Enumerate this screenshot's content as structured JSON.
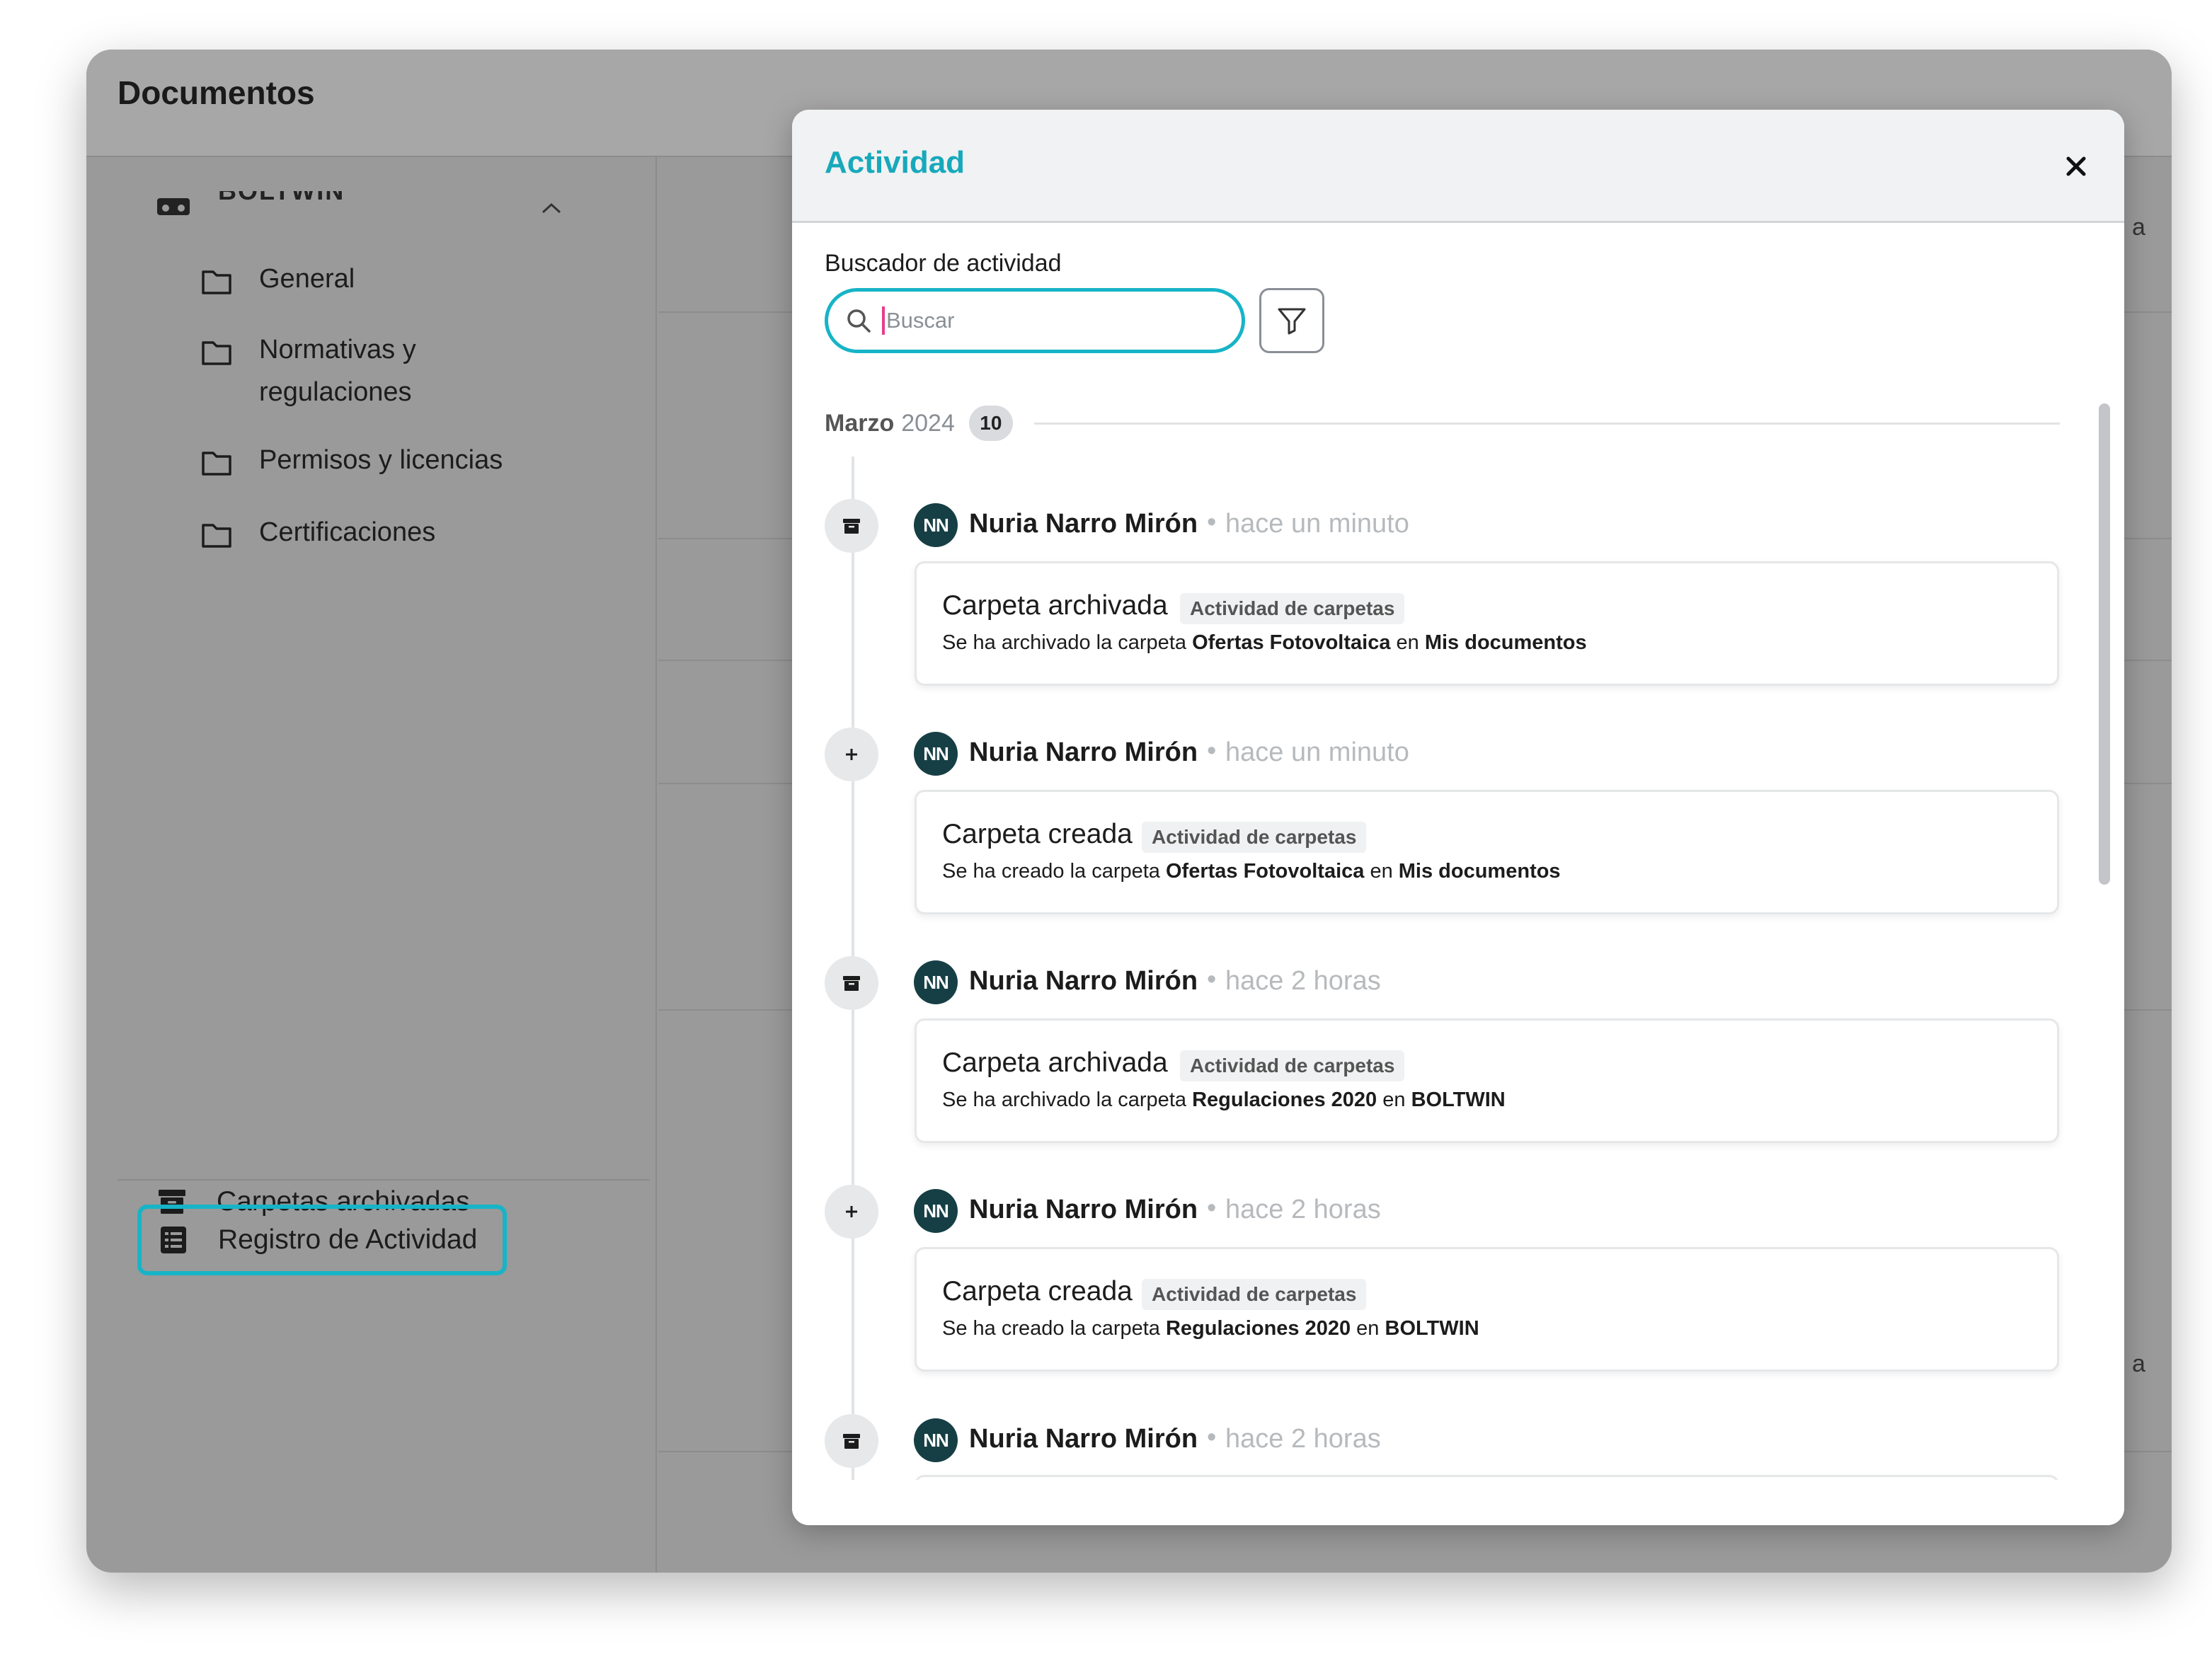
{
  "app": {
    "title": "Documentos"
  },
  "sidebar": {
    "workspace": "BOLTWIN",
    "folders": [
      {
        "label": "General"
      },
      {
        "label": "Normativas y"
      },
      {
        "label": "regulaciones"
      },
      {
        "label": "Permisos y licencias"
      },
      {
        "label": "Certificaciones"
      }
    ],
    "archived_label": "Carpetas archivadas",
    "activity_log_label": "Registro de Actividad"
  },
  "background": {
    "edge_text": "a"
  },
  "modal": {
    "title": "Actividad",
    "search_label": "Buscador de actividad",
    "search_placeholder": "Buscar",
    "month": "Marzo",
    "year": "2024",
    "count": "10",
    "separator": "•",
    "entries": [
      {
        "type_icon": "archive-icon",
        "initials": "NN",
        "user": "Nuria Narro Mirón",
        "time": "hace un minuto",
        "title": "Carpeta archivada",
        "tag": "Actividad de carpetas",
        "desc_prefix": "Se ha archivado la carpeta ",
        "folder": "Ofertas Fotovoltaica",
        "desc_mid": " en ",
        "location": "Mis documentos"
      },
      {
        "type_icon": "plus-icon",
        "initials": "NN",
        "user": "Nuria Narro Mirón",
        "time": "hace un minuto",
        "title": "Carpeta creada",
        "tag": "Actividad de carpetas",
        "desc_prefix": "Se ha creado la carpeta ",
        "folder": "Ofertas Fotovoltaica",
        "desc_mid": " en ",
        "location": "Mis documentos"
      },
      {
        "type_icon": "archive-icon",
        "initials": "NN",
        "user": "Nuria Narro Mirón",
        "time": "hace 2 horas",
        "title": "Carpeta archivada",
        "tag": "Actividad de carpetas",
        "desc_prefix": "Se ha archivado la carpeta ",
        "folder": "Regulaciones 2020",
        "desc_mid": " en ",
        "location": "BOLTWIN"
      },
      {
        "type_icon": "plus-icon",
        "initials": "NN",
        "user": "Nuria Narro Mirón",
        "time": "hace 2 horas",
        "title": "Carpeta creada",
        "tag": "Actividad de carpetas",
        "desc_prefix": "Se ha creado la carpeta ",
        "folder": "Regulaciones 2020",
        "desc_mid": " en ",
        "location": "BOLTWIN"
      },
      {
        "type_icon": "archive-icon",
        "initials": "NN",
        "user": "Nuria Narro Mirón",
        "time": "hace 2 horas"
      }
    ]
  },
  "colors": {
    "accent": "#17b4c7",
    "avatar": "#163f45",
    "cursor": "#e63e8c"
  }
}
